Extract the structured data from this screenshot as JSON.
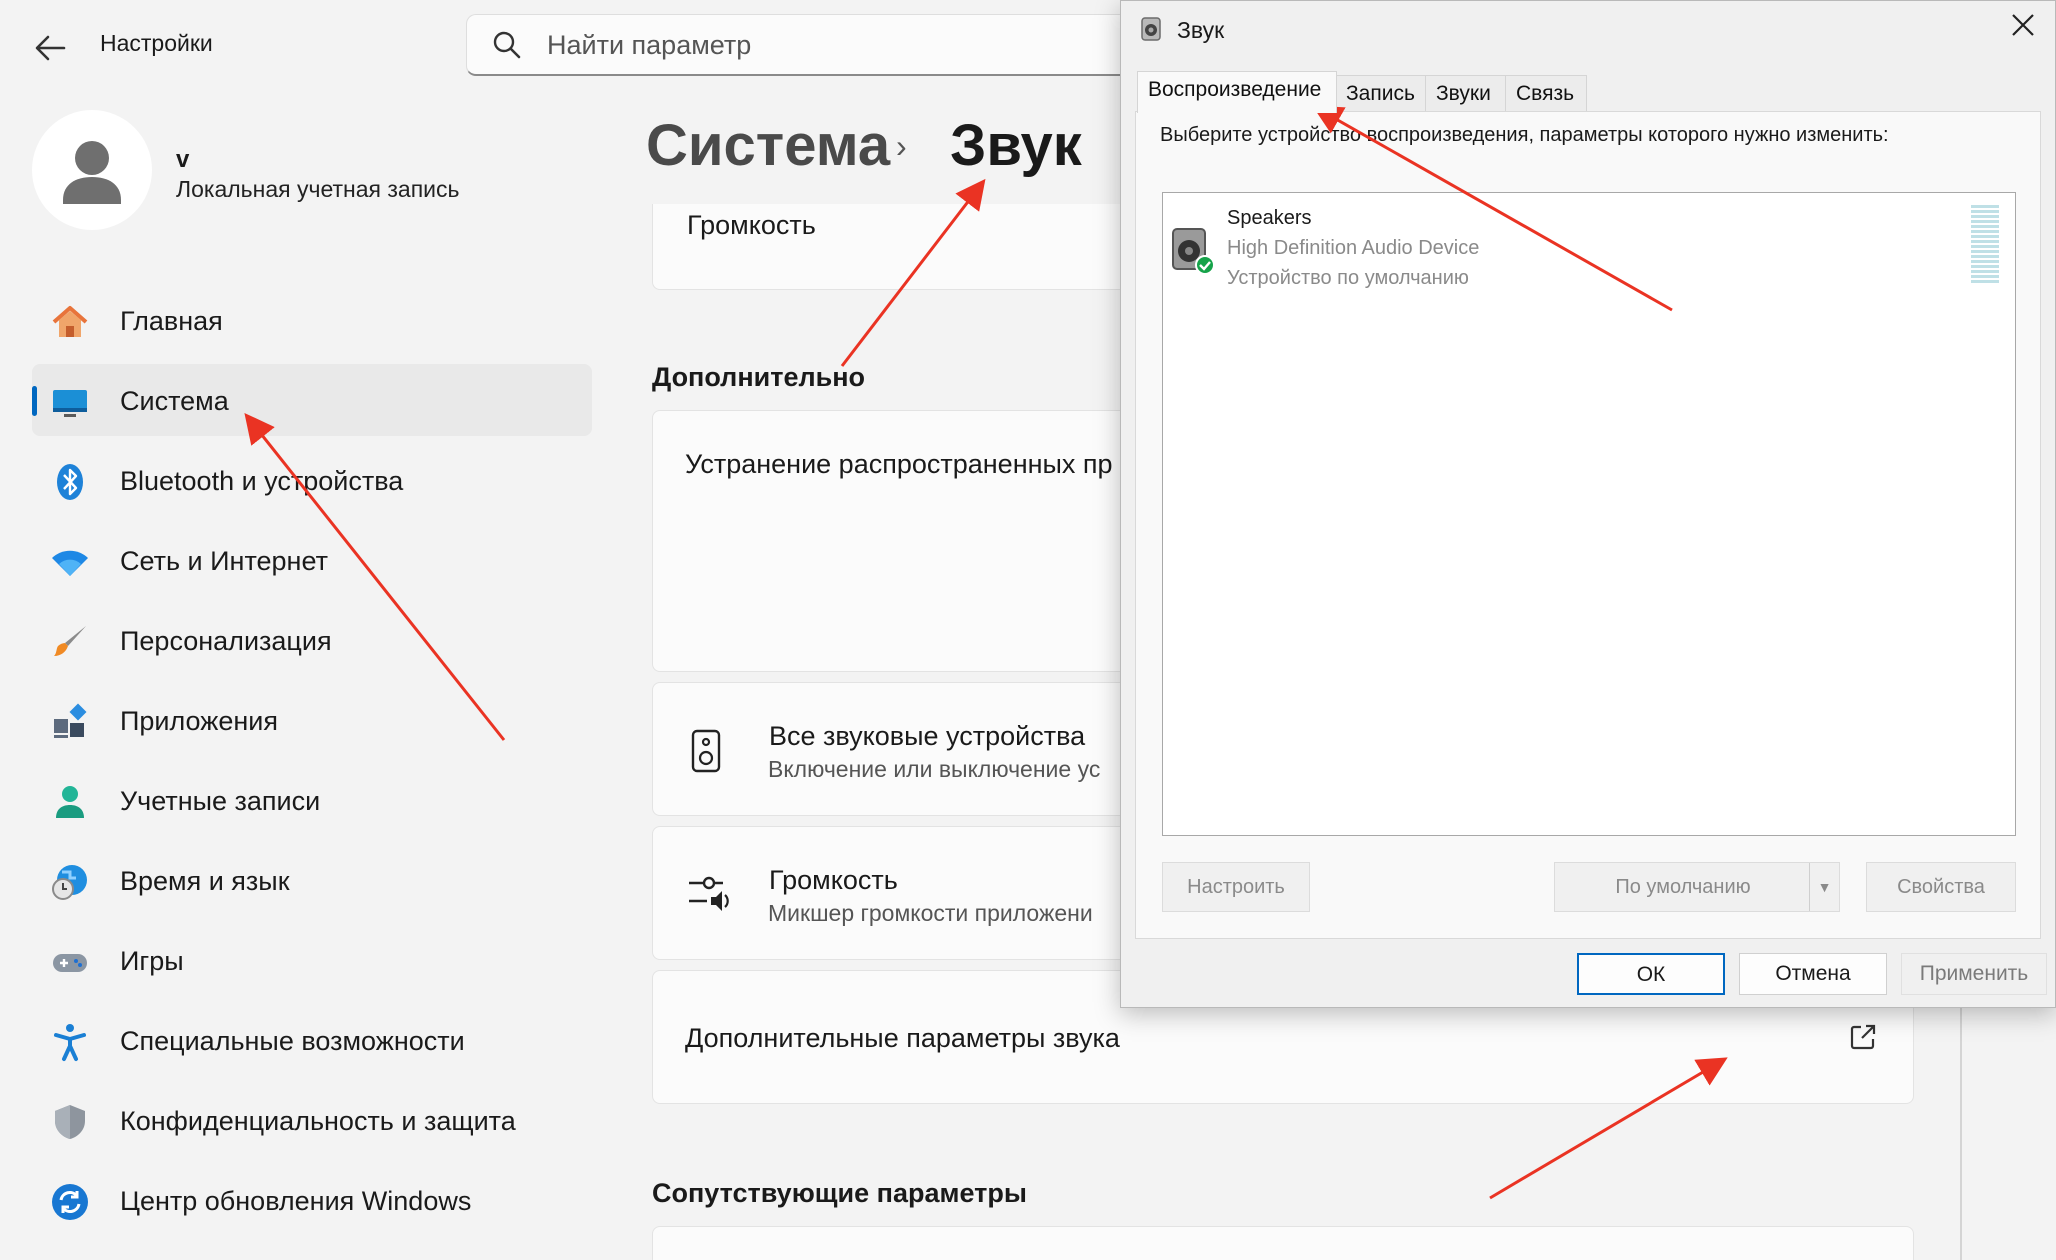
{
  "settings": {
    "title": "Настройки",
    "search_placeholder": "Найти параметр",
    "user": {
      "name": "v",
      "account_type": "Локальная учетная запись"
    },
    "nav": [
      {
        "label": "Главная",
        "icon": "home-icon"
      },
      {
        "label": "Система",
        "icon": "system-icon",
        "active": true
      },
      {
        "label": "Bluetooth и устройства",
        "icon": "bluetooth-icon"
      },
      {
        "label": "Сеть и Интернет",
        "icon": "wifi-icon"
      },
      {
        "label": "Персонализация",
        "icon": "brush-icon"
      },
      {
        "label": "Приложения",
        "icon": "apps-icon"
      },
      {
        "label": "Учетные записи",
        "icon": "accounts-icon"
      },
      {
        "label": "Время и язык",
        "icon": "time-language-icon"
      },
      {
        "label": "Игры",
        "icon": "gamepad-icon"
      },
      {
        "label": "Специальные возможности",
        "icon": "accessibility-icon"
      },
      {
        "label": "Конфиденциальность и защита",
        "icon": "shield-icon"
      },
      {
        "label": "Центр обновления Windows",
        "icon": "update-icon"
      }
    ],
    "breadcrumb": {
      "parent": "Система",
      "separator": "›",
      "current": "Звук"
    },
    "volume_card_title": "Громкость",
    "section_advanced": "Дополнительно",
    "troubleshoot_title": "Устранение распространенных пр",
    "all_devices": {
      "title": "Все звуковые устройства",
      "subtitle": "Включение или выключение ус"
    },
    "volume_mixer": {
      "title": "Громкость",
      "subtitle": "Микшер громкости приложени"
    },
    "more_settings": "Дополнительные параметры звука",
    "section_related": "Сопутствующие параметры"
  },
  "dialog": {
    "title": "Звук",
    "tabs": [
      "Воспроизведение",
      "Запись",
      "Звуки",
      "Связь"
    ],
    "active_tab": 0,
    "instruction": "Выберите устройство воспроизведения, параметры которого нужно изменить:",
    "device": {
      "name": "Speakers",
      "driver": "High Definition Audio Device",
      "status": "Устройство по умолчанию"
    },
    "buttons": {
      "configure": "Настроить",
      "set_default": "По умолчанию",
      "properties": "Свойства",
      "ok": "ОК",
      "cancel": "Отмена",
      "apply": "Применить"
    }
  },
  "colors": {
    "accent": "#0067c0",
    "arrow": "#ea3323",
    "default_check": "#16a34a"
  }
}
